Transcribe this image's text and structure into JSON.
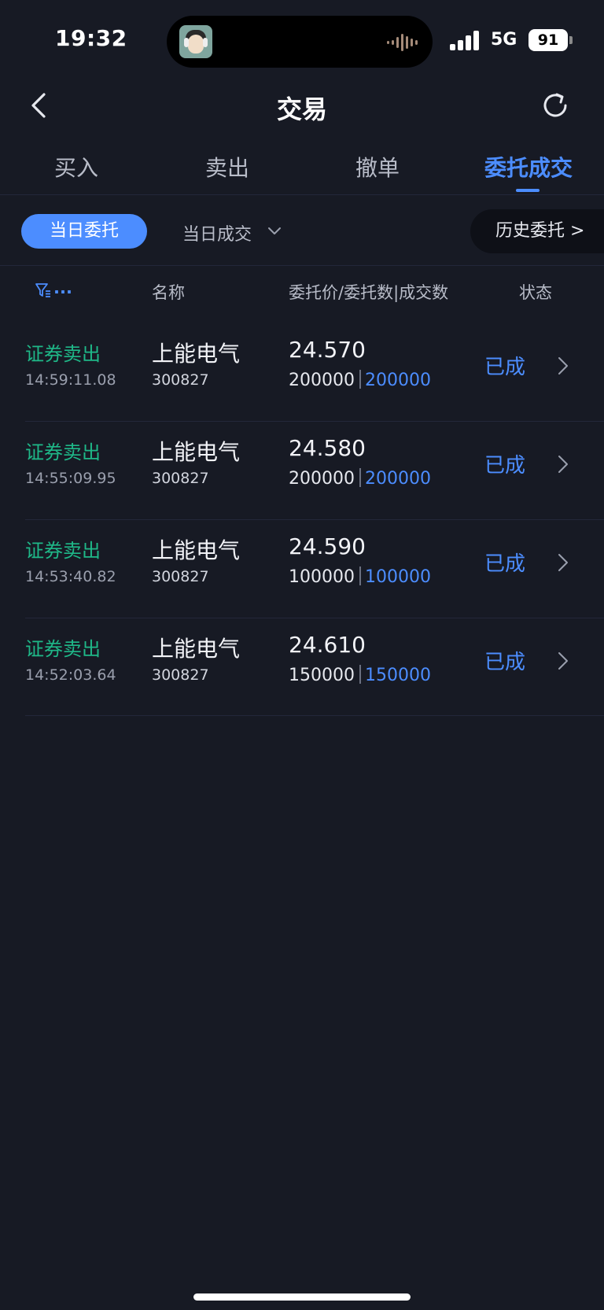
{
  "status_bar": {
    "time": "19:32",
    "network": "5G",
    "battery": "91"
  },
  "nav": {
    "title": "交易"
  },
  "tabs": [
    {
      "label": "买入"
    },
    {
      "label": "卖出"
    },
    {
      "label": "撤单"
    },
    {
      "label": "委托成交",
      "active": true
    }
  ],
  "filters": {
    "today_orders": "当日委托",
    "today_deals": "当日成交",
    "history": "历史委托 >"
  },
  "header": {
    "filter_more": "...",
    "name": "名称",
    "price_qty": "委托价/委托数|成交数",
    "status": "状态"
  },
  "rows": [
    {
      "side": "证券卖出",
      "time": "14:59:11.08",
      "name": "上能电气",
      "code": "300827",
      "price": "24.570",
      "order_qty": "200000",
      "deal_qty": "200000",
      "status": "已成"
    },
    {
      "side": "证券卖出",
      "time": "14:55:09.95",
      "name": "上能电气",
      "code": "300827",
      "price": "24.580",
      "order_qty": "200000",
      "deal_qty": "200000",
      "status": "已成"
    },
    {
      "side": "证券卖出",
      "time": "14:53:40.82",
      "name": "上能电气",
      "code": "300827",
      "price": "24.590",
      "order_qty": "100000",
      "deal_qty": "100000",
      "status": "已成"
    },
    {
      "side": "证券卖出",
      "time": "14:52:03.64",
      "name": "上能电气",
      "code": "300827",
      "price": "24.610",
      "order_qty": "150000",
      "deal_qty": "150000",
      "status": "已成"
    }
  ],
  "colors": {
    "accent": "#4c8dff",
    "sell": "#1fb888",
    "background": "#171a24"
  }
}
